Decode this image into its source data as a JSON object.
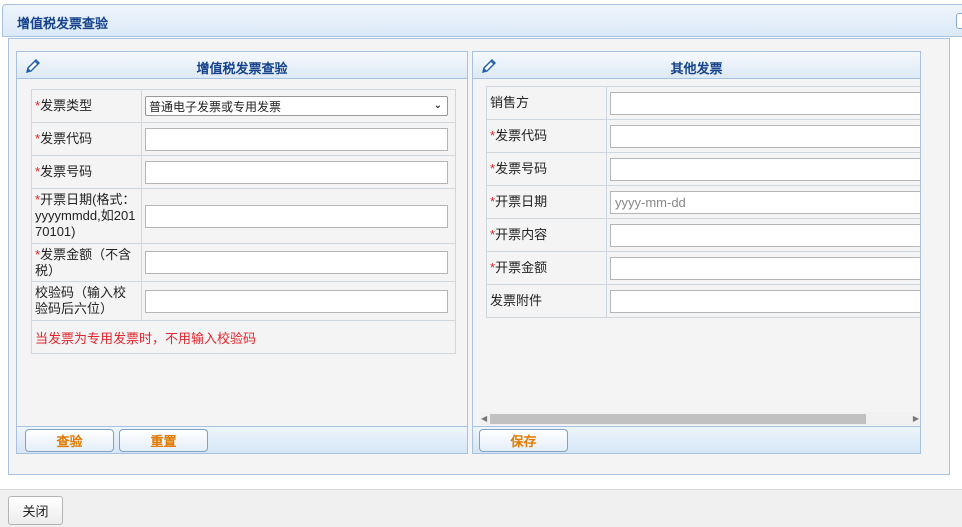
{
  "window": {
    "title": "增值税发票查验"
  },
  "left_panel": {
    "title": "增值税发票查验",
    "rows": [
      {
        "required": true,
        "label": "发票类型",
        "type": "select",
        "value": "普通电子发票或专用发票"
      },
      {
        "required": true,
        "label": "发票代码",
        "type": "text",
        "value": ""
      },
      {
        "required": true,
        "label": "发票号码",
        "type": "text",
        "value": ""
      },
      {
        "required": true,
        "label": "开票日期(格式：yyyymmdd,如20170101)",
        "type": "text",
        "value": ""
      },
      {
        "required": true,
        "label": "发票金额（不含税）",
        "type": "text",
        "value": ""
      },
      {
        "required": false,
        "label": "校验码（输入校验码后六位）",
        "type": "text",
        "value": ""
      }
    ],
    "note": "当发票为专用发票时，不用输入校验码",
    "buttons": {
      "check": "查验",
      "reset": "重置"
    }
  },
  "right_panel": {
    "title": "其他发票",
    "rows": [
      {
        "required": false,
        "label": "销售方",
        "value": "",
        "placeholder": ""
      },
      {
        "required": true,
        "label": "发票代码",
        "value": "",
        "placeholder": ""
      },
      {
        "required": true,
        "label": "发票号码",
        "value": "",
        "placeholder": ""
      },
      {
        "required": true,
        "label": "开票日期",
        "value": "",
        "placeholder": "yyyy-mm-dd"
      },
      {
        "required": true,
        "label": "开票内容",
        "value": "",
        "placeholder": ""
      },
      {
        "required": true,
        "label": "开票金额",
        "value": "",
        "placeholder": ""
      },
      {
        "required": false,
        "label": "发票附件",
        "value": "",
        "placeholder": ""
      }
    ],
    "buttons": {
      "save": "保存"
    }
  },
  "footer": {
    "close": "关闭"
  },
  "required_mark": "*",
  "icons": {
    "panel_edit": "pencil-icon",
    "select_arrow": "chevron-down-icon",
    "scroll_left": "arrow-left-icon",
    "scroll_right": "arrow-right-icon"
  },
  "colors": {
    "header_text": "#15428b",
    "required": "#e02020",
    "note": "#e0262e",
    "button_text": "#e07b00"
  }
}
